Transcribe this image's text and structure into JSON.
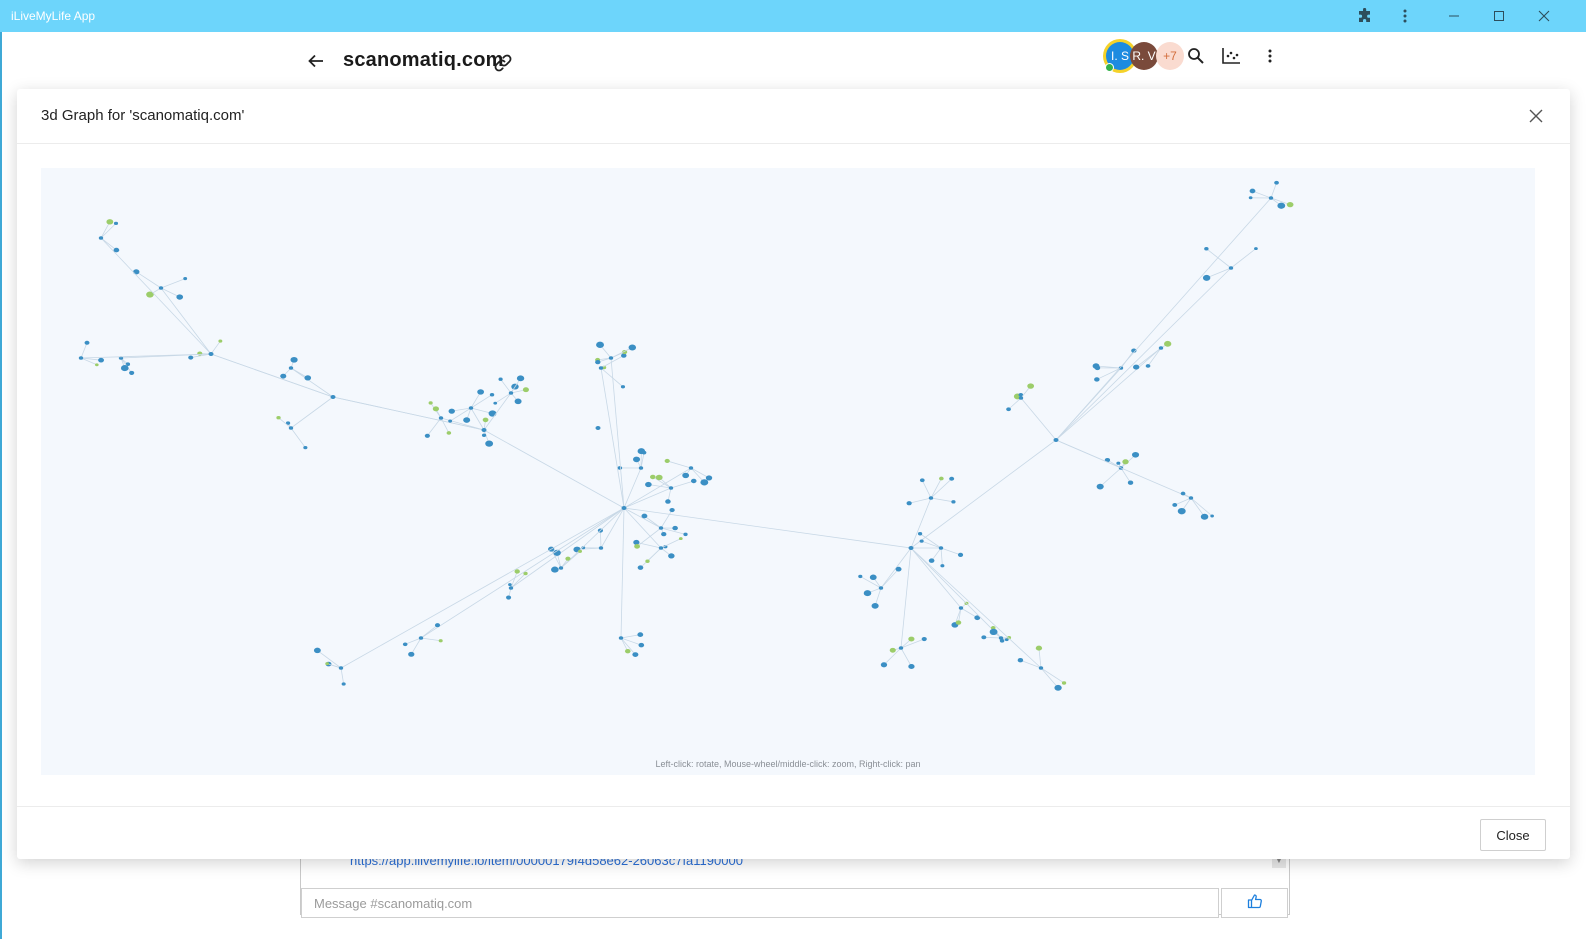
{
  "window": {
    "title": "iLiveMyLife App"
  },
  "header": {
    "title": "scanomatiq.com",
    "avatars": [
      {
        "initials": "I. S",
        "color": "#1d8be0"
      },
      {
        "initials": "R. V",
        "color": "#7a4a3b"
      },
      {
        "initials": "+7",
        "color": "#fadbd0"
      }
    ],
    "icons": [
      "back-arrow-icon",
      "link-icon",
      "search-icon",
      "chart-icon",
      "more-vertical-icon"
    ]
  },
  "chat": {
    "url_text": "https://app.ilivemylife.io/item/00000179f4d58e62-26063c7fa1190000",
    "message_placeholder": "Message #scanomatiq.com"
  },
  "modal": {
    "title": "3d Graph for 'scanomatiq.com'",
    "hint": "Left-click: rotate, Mouse-wheel/middle-click: zoom, Right-click: pan",
    "close_label": "Close"
  },
  "colors": {
    "titlebar": "#6dd5fb",
    "node_blue": "#3b8fc4",
    "node_green": "#9ccd6a",
    "graph_bg": "#f4f8fd"
  }
}
